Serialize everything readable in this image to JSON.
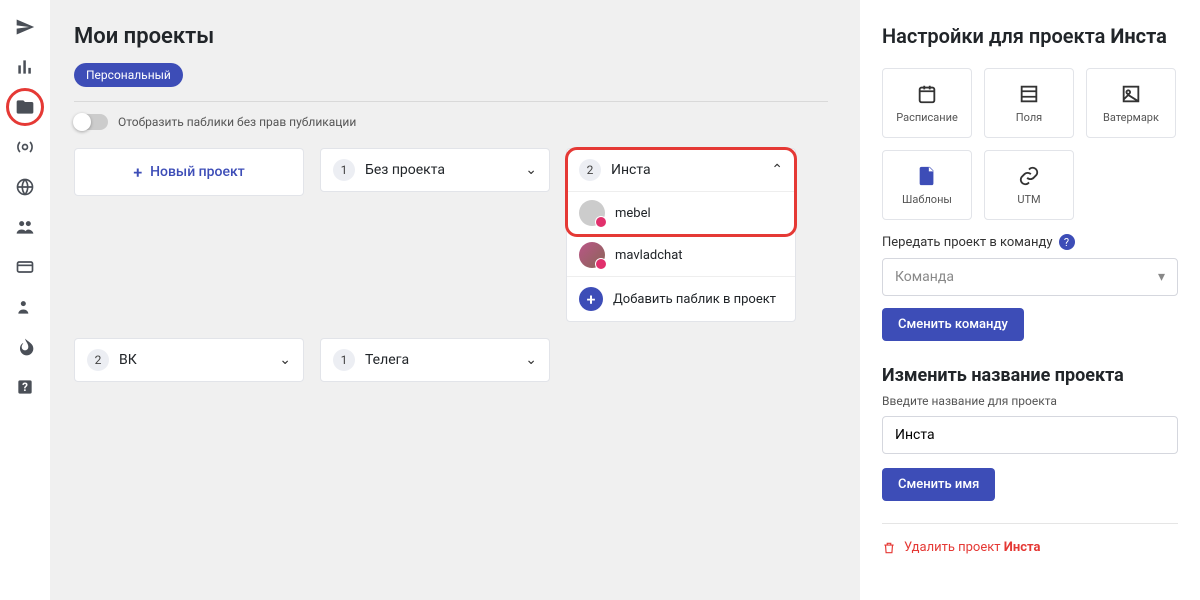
{
  "main": {
    "title": "Мои проекты",
    "personalBadge": "Персональный",
    "toggleLabel": "Отобразить паблики без прав публикации",
    "newProject": "Новый проект",
    "projects": [
      {
        "count": "1",
        "name": "Без проекта"
      },
      {
        "count": "2",
        "name": "Инста"
      },
      {
        "count": "2",
        "name": "ВК"
      },
      {
        "count": "1",
        "name": "Телега"
      }
    ],
    "expanded": {
      "publics": [
        {
          "name": "mebel"
        },
        {
          "name": "mavladchat"
        }
      ],
      "addLabel": "Добавить паблик в проект"
    }
  },
  "right": {
    "titlePrefix": "Настройки для проекта ",
    "titleProject": "Инста",
    "tiles": {
      "schedule": "Расписание",
      "fields": "Поля",
      "watermark": "Ватермарк",
      "templates": "Шаблоны",
      "utm": "UTM"
    },
    "teamLabel": "Передать проект в команду",
    "teamPlaceholder": "Команда",
    "changeTeamBtn": "Сменить команду",
    "renameTitle": "Изменить название проекта",
    "renameLabel": "Введите название для проекта",
    "renameValue": "Инста",
    "renameBtn": "Сменить имя",
    "deletePrefix": "Удалить проект ",
    "deleteProject": "Инста"
  }
}
